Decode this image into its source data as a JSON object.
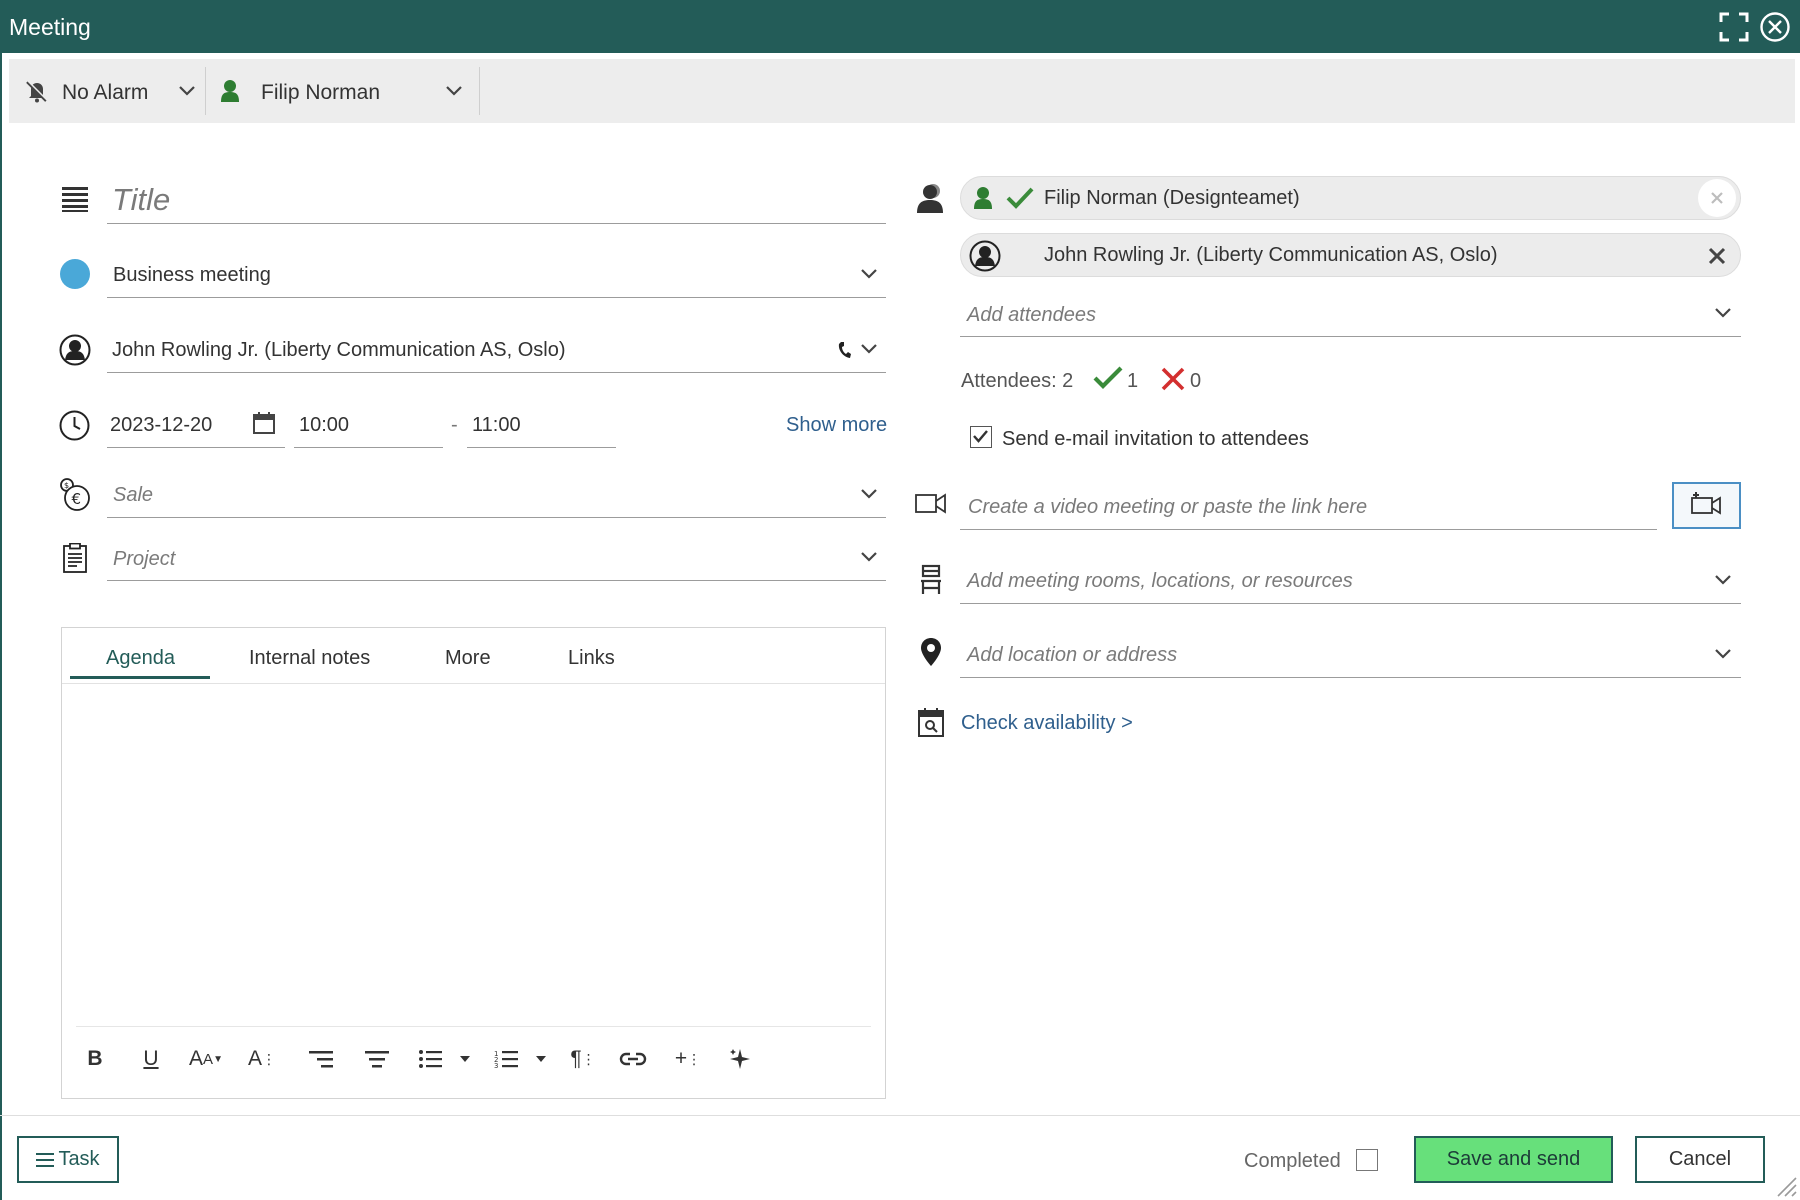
{
  "window": {
    "title": "Meeting"
  },
  "toolbar": {
    "alarm_label": "No Alarm",
    "owner_label": "Filip Norman"
  },
  "form": {
    "title_placeholder": "Title",
    "type_value": "Business meeting",
    "type_color": "#4aa8d8",
    "contact_value": "John Rowling Jr. (Liberty Communication AS, Oslo)",
    "date_value": "2023-12-20",
    "start_time": "10:00",
    "time_separator": "-",
    "end_time": "11:00",
    "show_more": "Show more",
    "sale_placeholder": "Sale",
    "project_placeholder": "Project"
  },
  "editor": {
    "tabs": [
      "Agenda",
      "Internal notes",
      "More",
      "Links"
    ],
    "active_tab": "Agenda"
  },
  "participants": {
    "chips": [
      {
        "label": "Filip Norman (Designteamet)"
      },
      {
        "label": "John Rowling Jr. (Liberty Communication AS, Oslo)"
      }
    ],
    "add_placeholder": "Add attendees",
    "attendees_label": "Attendees: 2",
    "accepted_count": "1",
    "declined_count": "0",
    "send_invitation_label": "Send e-mail invitation to attendees",
    "send_invitation_checked": true,
    "video_placeholder": "Create a video meeting or paste the link here",
    "resources_placeholder": "Add meeting rooms, locations, or resources",
    "location_placeholder": "Add location or address",
    "check_availability": "Check availability >"
  },
  "footer": {
    "task_label": "Task",
    "completed_label": "Completed",
    "save_label": "Save and send",
    "cancel_label": "Cancel"
  },
  "colors": {
    "brand": "#235c58",
    "save_button": "#67e07b",
    "accepted": "#3a8b3a",
    "declined": "#d32f2f",
    "link": "#2f5f8d"
  }
}
